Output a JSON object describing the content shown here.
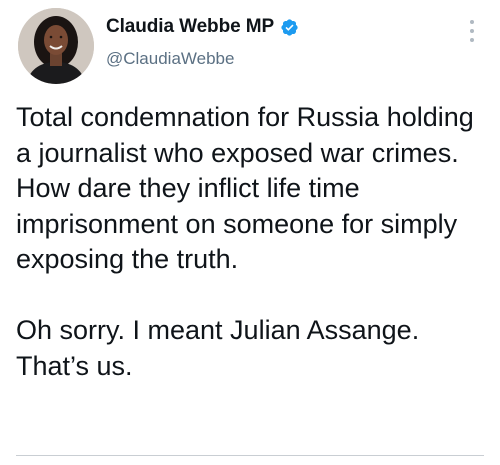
{
  "tweet": {
    "author": {
      "display_name": "Claudia Webbe MP",
      "handle": "@ClaudiaWebbe",
      "verified": true,
      "avatar_icon": "profile-photo",
      "verified_color": "#1d9bf0"
    },
    "menu_icon": "more-vertical-icon",
    "text_paragraphs": [
      "Total condemnation for Russia holding a journalist who exposed war crimes. How dare they inflict life time imprisonment on someone for simply exposing the truth.",
      "Oh sorry. I meant Julian Assange. That’s us."
    ]
  },
  "colors": {
    "text": "#0f1419",
    "secondary_text": "#5b7083",
    "verified_badge": "#1d9bf0"
  }
}
